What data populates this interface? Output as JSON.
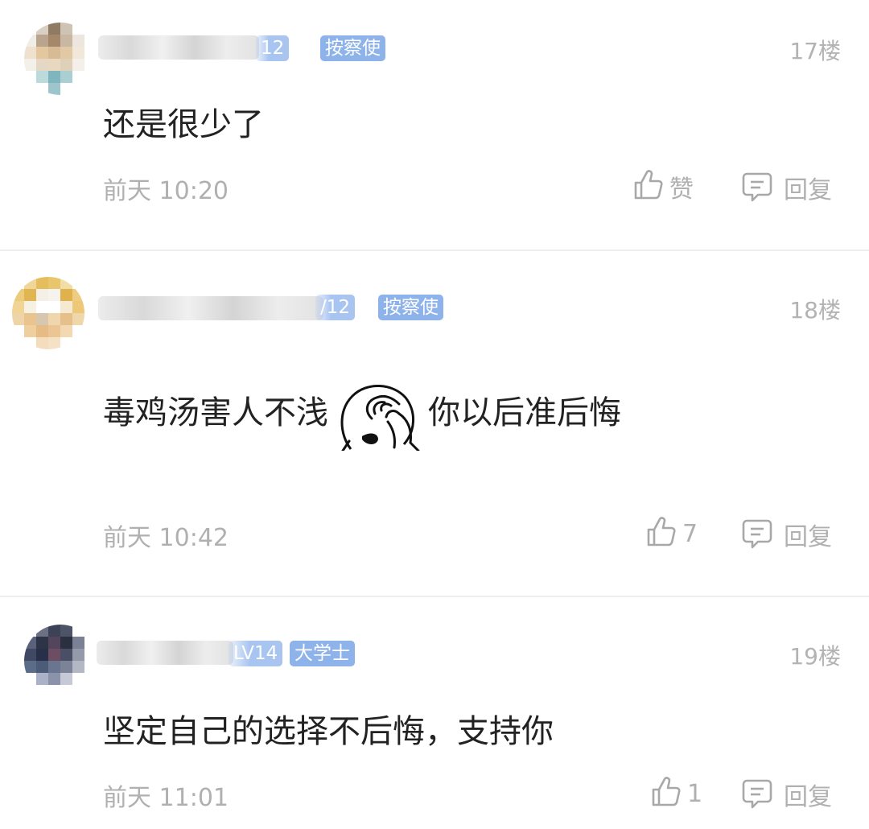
{
  "comments": [
    {
      "level_badge": "12",
      "title_badge": "按察使",
      "floor": "17楼",
      "content": "还是很少了",
      "time": "前天 10:20",
      "like_label": "赞",
      "reply_label": "回复"
    },
    {
      "level_badge": "/12",
      "title_badge": "按察使",
      "floor": "18楼",
      "content_before": "毒鸡汤害人不浅",
      "emoji": "facepalm-emoji",
      "content_after": "你以后准后悔",
      "time": "前天 10:42",
      "like_label": "7",
      "reply_label": "回复"
    },
    {
      "level_badge": "LV14",
      "title_badge": "大学士",
      "floor": "19楼",
      "content": "坚定自己的选择不后悔，支持你",
      "time": "前天 11:01",
      "like_label": "1",
      "reply_label": "回复"
    }
  ],
  "colors": {
    "badge_blue": "#8eb2ea",
    "meta_gray": "#b0b0b0",
    "text": "#222222",
    "divider": "#eeeeee"
  },
  "icons": [
    "thumbs-up-icon",
    "reply-icon"
  ]
}
